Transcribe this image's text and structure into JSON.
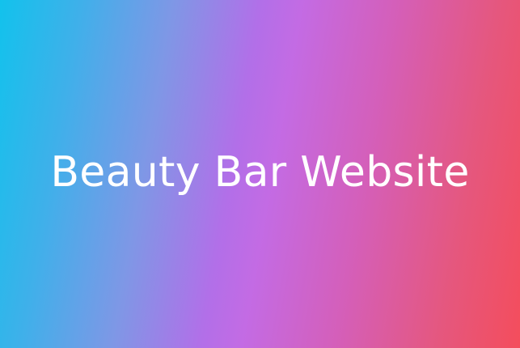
{
  "banner": {
    "title": "Beauty Bar Website",
    "gradient_colors": [
      "#12c2ec",
      "#c36be4",
      "#f44d5c"
    ],
    "text_color": "#ffffff"
  }
}
